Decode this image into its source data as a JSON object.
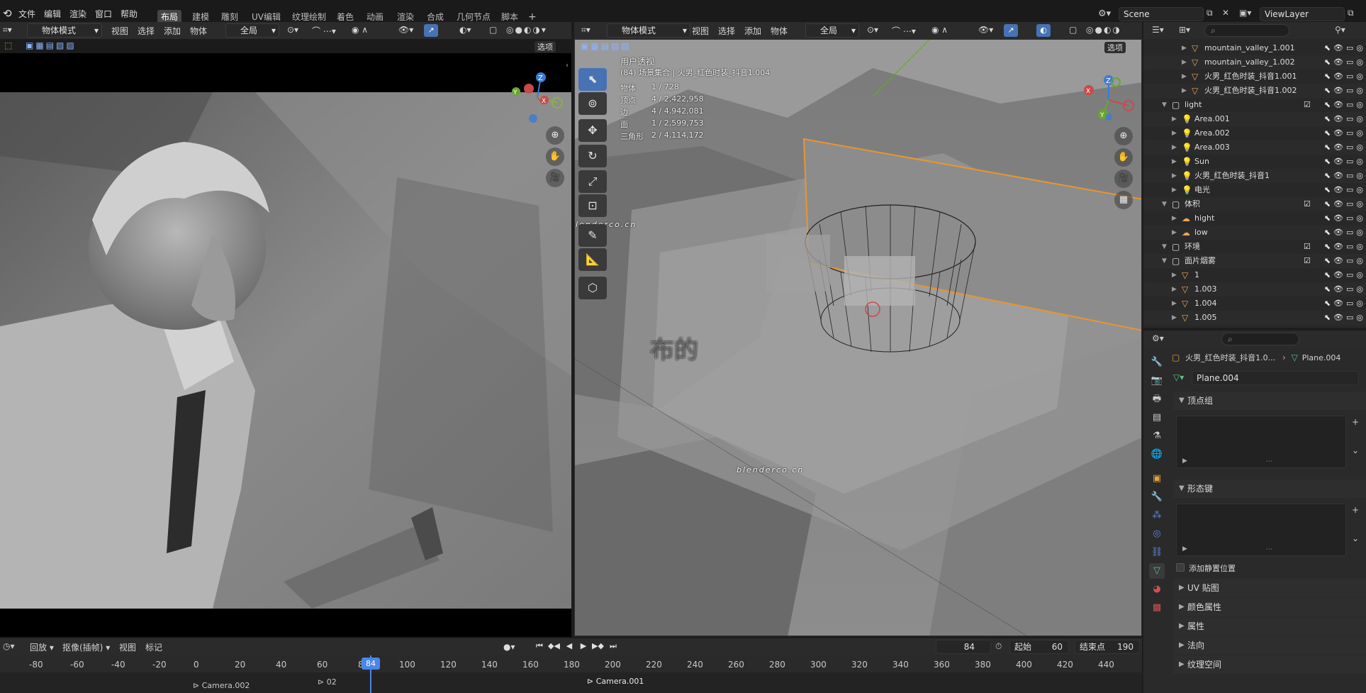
{
  "topbar": {
    "menus": [
      "文件",
      "编辑",
      "渲染",
      "窗口",
      "帮助"
    ],
    "workspaces": [
      "布局",
      "建模",
      "雕刻",
      "UV编辑",
      "纹理绘制",
      "着色",
      "动画",
      "渲染",
      "合成",
      "几何节点",
      "脚本"
    ],
    "add_tab": "+",
    "scene": "Scene",
    "viewlayer": "ViewLayer"
  },
  "left_header": {
    "mode": "物体模式",
    "menus": [
      "视图",
      "选择",
      "添加",
      "物体"
    ],
    "orientation": "全局",
    "options": "选项"
  },
  "right_header": {
    "mode": "物体模式",
    "menus": [
      "视图",
      "选择",
      "添加",
      "物体"
    ],
    "orientation": "全局",
    "options": "选项"
  },
  "viewport_overlay": {
    "view_name": "用户透视",
    "collection": "(84) 场景集合 | 火男_红色时装_抖音1.004",
    "stats": [
      {
        "label": "物体",
        "value": "1 / 728"
      },
      {
        "label": "顶点",
        "value": "4 / 2,422,958"
      },
      {
        "label": "边",
        "value": "4 / 4,942,081"
      },
      {
        "label": "面",
        "value": "1 / 2,599,753"
      },
      {
        "label": "三角形",
        "value": "2 / 4,114,172"
      }
    ],
    "watermark_top": "blenderco.cn",
    "watermark_mid": "blenderco.cn",
    "watermark_big": "布的"
  },
  "gizmo": {
    "z": "Z",
    "y": "Y",
    "x": "X"
  },
  "outliner": {
    "rows": [
      {
        "name": "mountain_valley_1.001",
        "indent": 3,
        "icon": "mesh",
        "check": false
      },
      {
        "name": "mountain_valley_1.002",
        "indent": 3,
        "icon": "mesh",
        "check": false
      },
      {
        "name": "火男_红色时装_抖音1.001",
        "indent": 3,
        "icon": "mesh",
        "check": false
      },
      {
        "name": "火男_红色时装_抖音1.002",
        "indent": 3,
        "icon": "mesh",
        "check": false
      },
      {
        "name": "light",
        "indent": 1,
        "icon": "collection",
        "check": true
      },
      {
        "name": "Area.001",
        "indent": 2,
        "icon": "light",
        "check": false
      },
      {
        "name": "Area.002",
        "indent": 2,
        "icon": "light",
        "check": false
      },
      {
        "name": "Area.003",
        "indent": 2,
        "icon": "light",
        "check": false
      },
      {
        "name": "Sun",
        "indent": 2,
        "icon": "light",
        "check": false
      },
      {
        "name": "火男_红色时装_抖音1",
        "indent": 2,
        "icon": "light",
        "check": false
      },
      {
        "name": "电光",
        "indent": 2,
        "icon": "light",
        "check": false
      },
      {
        "name": "体积",
        "indent": 1,
        "icon": "collection",
        "check": true
      },
      {
        "name": "hight",
        "indent": 2,
        "icon": "volume",
        "check": false
      },
      {
        "name": "low",
        "indent": 2,
        "icon": "volume",
        "check": false
      },
      {
        "name": "环境",
        "indent": 1,
        "icon": "collection",
        "check": true
      },
      {
        "name": "面片烟雾",
        "indent": 1,
        "icon": "collection",
        "check": true
      },
      {
        "name": "1",
        "indent": 2,
        "icon": "mesh",
        "check": false
      },
      {
        "name": "1.003",
        "indent": 2,
        "icon": "mesh",
        "check": false
      },
      {
        "name": "1.004",
        "indent": 2,
        "icon": "mesh",
        "check": false
      },
      {
        "name": "1.005",
        "indent": 2,
        "icon": "mesh",
        "check": false
      }
    ]
  },
  "properties": {
    "object": "火男_红色时装_抖音1.0...",
    "data_name": "Plane.004",
    "mesh_name": "Plane.004",
    "panels": {
      "vertex_groups": "顶点组",
      "shape_keys": "形态键",
      "rest_position": "添加静置位置",
      "uv_maps": "UV 贴图",
      "color_attrs": "颜色属性",
      "attributes": "属性",
      "normals": "法向",
      "texture_space": "纹理空间"
    }
  },
  "timeline": {
    "menus": [
      "回放",
      "抠像(插帧)",
      "视图",
      "标记"
    ],
    "current_frame": "84",
    "start_label": "起始",
    "start": "60",
    "end_label": "结束点",
    "end": "190",
    "ticks": [
      "-80",
      "-60",
      "-40",
      "-20",
      "0",
      "20",
      "40",
      "60",
      "8",
      "84",
      "100",
      "120",
      "140",
      "160",
      "180",
      "200",
      "220",
      "240",
      "260",
      "280",
      "300",
      "320",
      "340",
      "360",
      "380",
      "400",
      "420",
      "440"
    ],
    "markers": [
      "Camera.002",
      "02",
      "Camera.001"
    ]
  }
}
